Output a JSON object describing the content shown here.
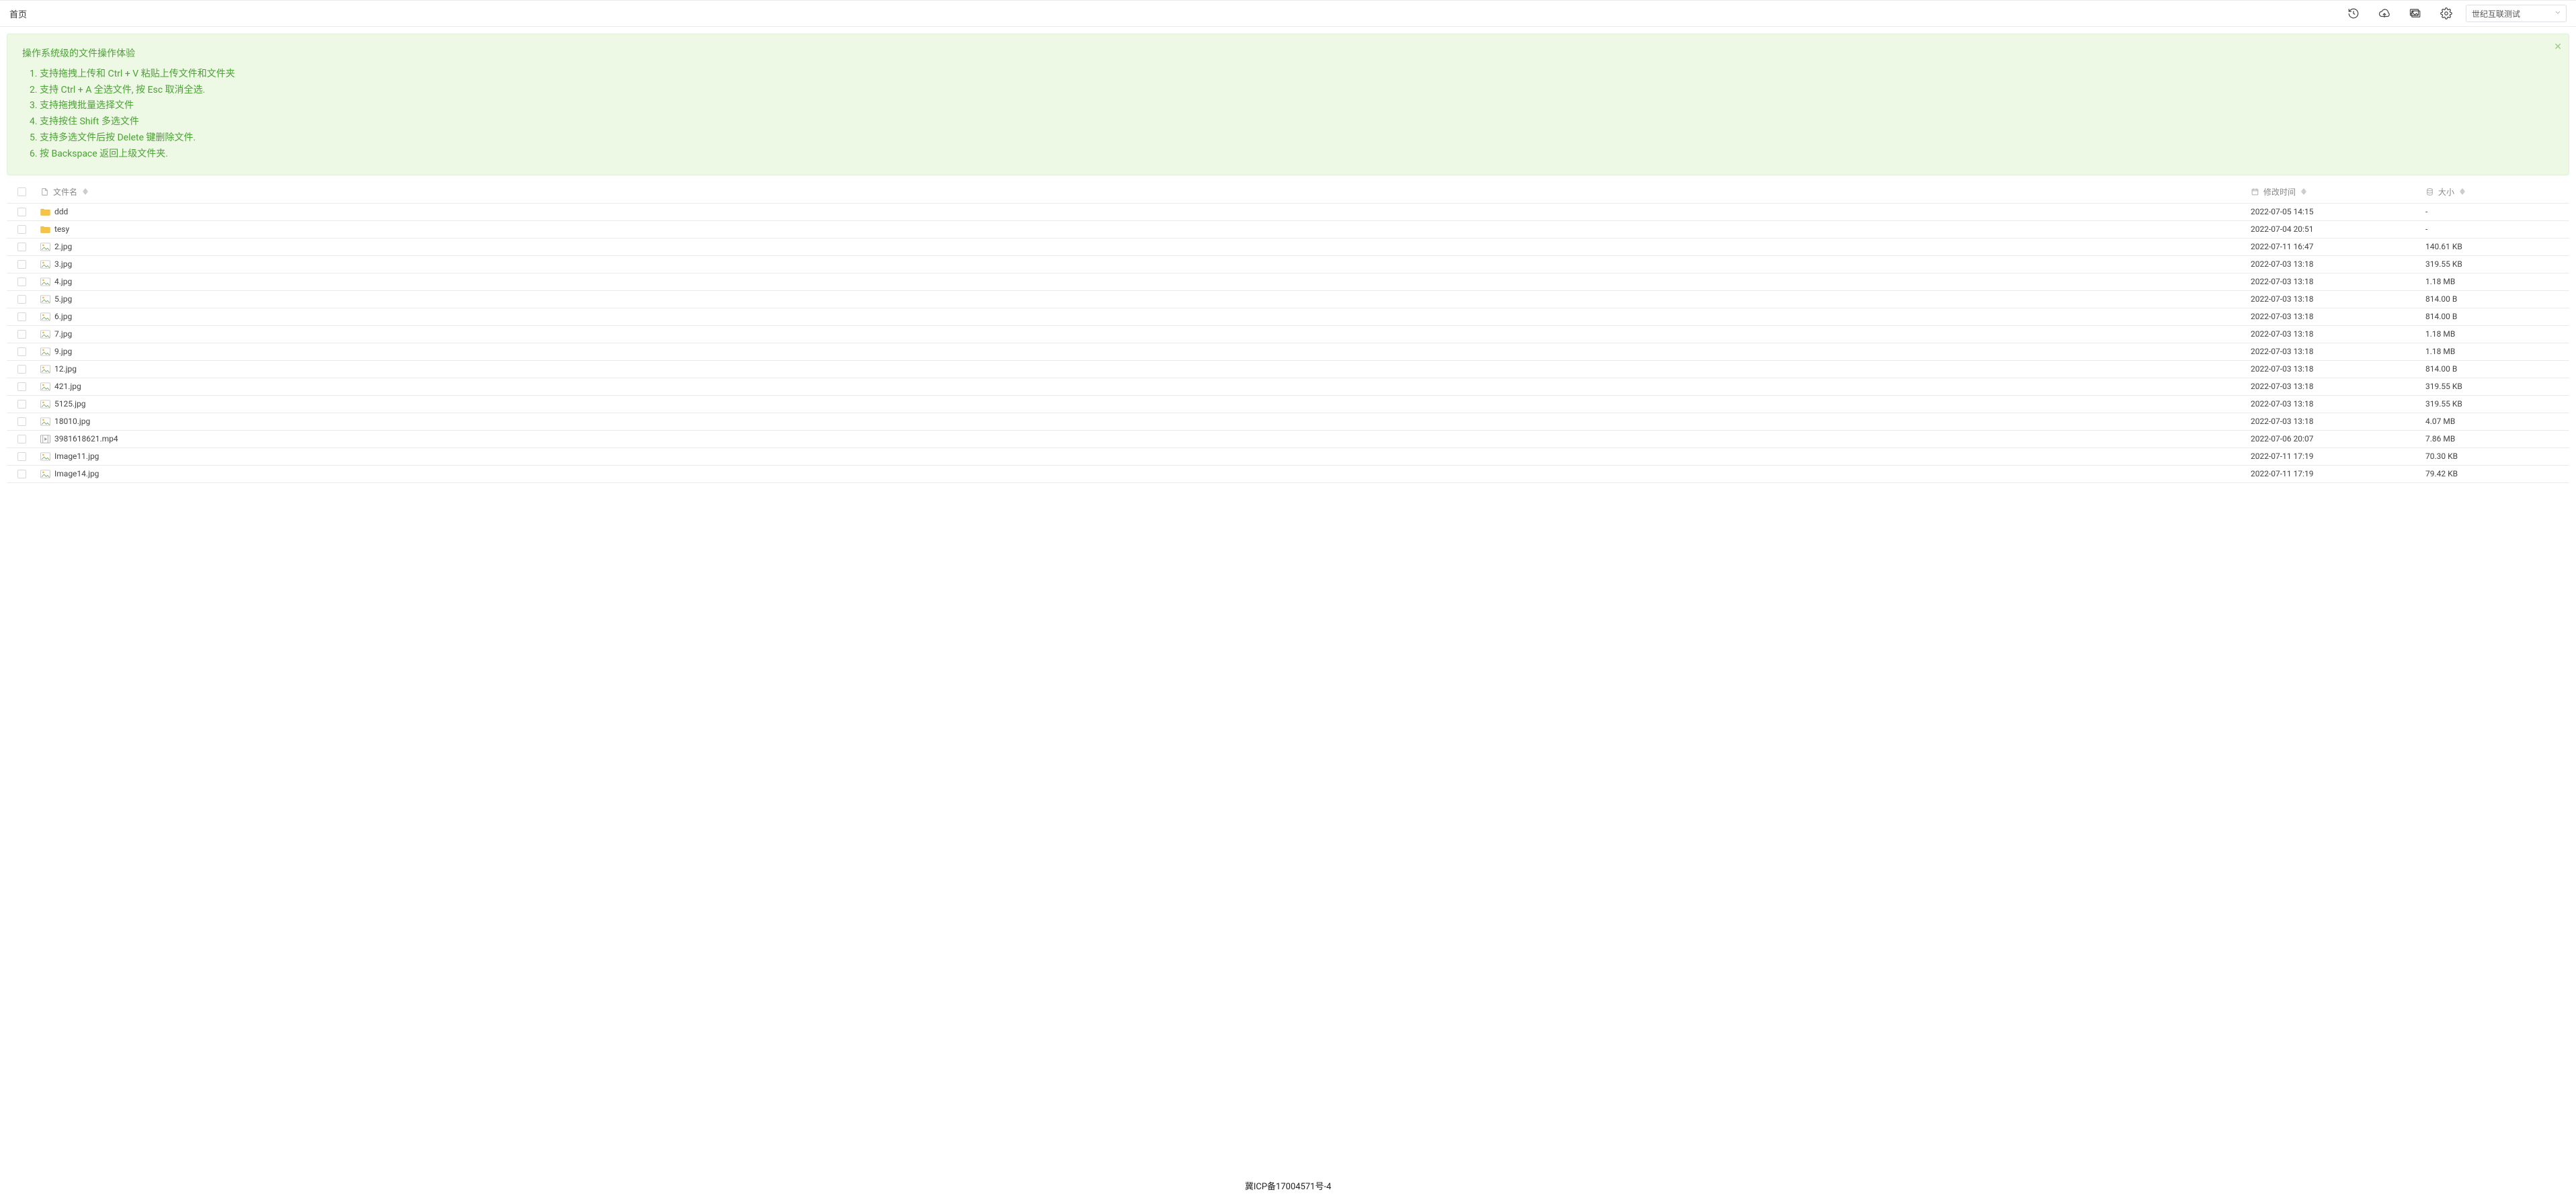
{
  "breadcrumb": {
    "home": "首页"
  },
  "account_selector": {
    "selected": "世纪互联测试"
  },
  "banner": {
    "title": "操作系统级的文件操作体验",
    "tips": [
      "支持拖拽上传和 Ctrl + V 粘贴上传文件和文件夹",
      "支持 Ctrl + A 全选文件, 按 Esc 取消全选.",
      "支持拖拽批量选择文件",
      "支持按住 Shift 多选文件",
      "支持多选文件后按 Delete 键删除文件.",
      "按 Backspace 返回上级文件夹."
    ]
  },
  "columns": {
    "name": "文件名",
    "mtime": "修改时间",
    "size": "大小"
  },
  "rows": [
    {
      "kind": "folder",
      "name": "ddd",
      "mtime": "2022-07-05 14:15",
      "size": "-"
    },
    {
      "kind": "folder",
      "name": "tesy",
      "mtime": "2022-07-04 20:51",
      "size": "-"
    },
    {
      "kind": "image",
      "name": "2.jpg",
      "mtime": "2022-07-11 16:47",
      "size": "140.61 KB"
    },
    {
      "kind": "image",
      "name": "3.jpg",
      "mtime": "2022-07-03 13:18",
      "size": "319.55 KB"
    },
    {
      "kind": "image",
      "name": "4.jpg",
      "mtime": "2022-07-03 13:18",
      "size": "1.18 MB"
    },
    {
      "kind": "image",
      "name": "5.jpg",
      "mtime": "2022-07-03 13:18",
      "size": "814.00 B"
    },
    {
      "kind": "image",
      "name": "6.jpg",
      "mtime": "2022-07-03 13:18",
      "size": "814.00 B"
    },
    {
      "kind": "image",
      "name": "7.jpg",
      "mtime": "2022-07-03 13:18",
      "size": "1.18 MB"
    },
    {
      "kind": "image",
      "name": "9.jpg",
      "mtime": "2022-07-03 13:18",
      "size": "1.18 MB"
    },
    {
      "kind": "image",
      "name": "12.jpg",
      "mtime": "2022-07-03 13:18",
      "size": "814.00 B"
    },
    {
      "kind": "image",
      "name": "421.jpg",
      "mtime": "2022-07-03 13:18",
      "size": "319.55 KB"
    },
    {
      "kind": "image",
      "name": "5125.jpg",
      "mtime": "2022-07-03 13:18",
      "size": "319.55 KB"
    },
    {
      "kind": "image",
      "name": "18010.jpg",
      "mtime": "2022-07-03 13:18",
      "size": "4.07 MB"
    },
    {
      "kind": "video",
      "name": "3981618621.mp4",
      "mtime": "2022-07-06 20:07",
      "size": "7.86 MB"
    },
    {
      "kind": "image",
      "name": "Image11.jpg",
      "mtime": "2022-07-11 17:19",
      "size": "70.30 KB"
    },
    {
      "kind": "image",
      "name": "Image14.jpg",
      "mtime": "2022-07-11 17:19",
      "size": "79.42 KB"
    }
  ],
  "footer": {
    "icp": "冀ICP备17004571号-4"
  }
}
